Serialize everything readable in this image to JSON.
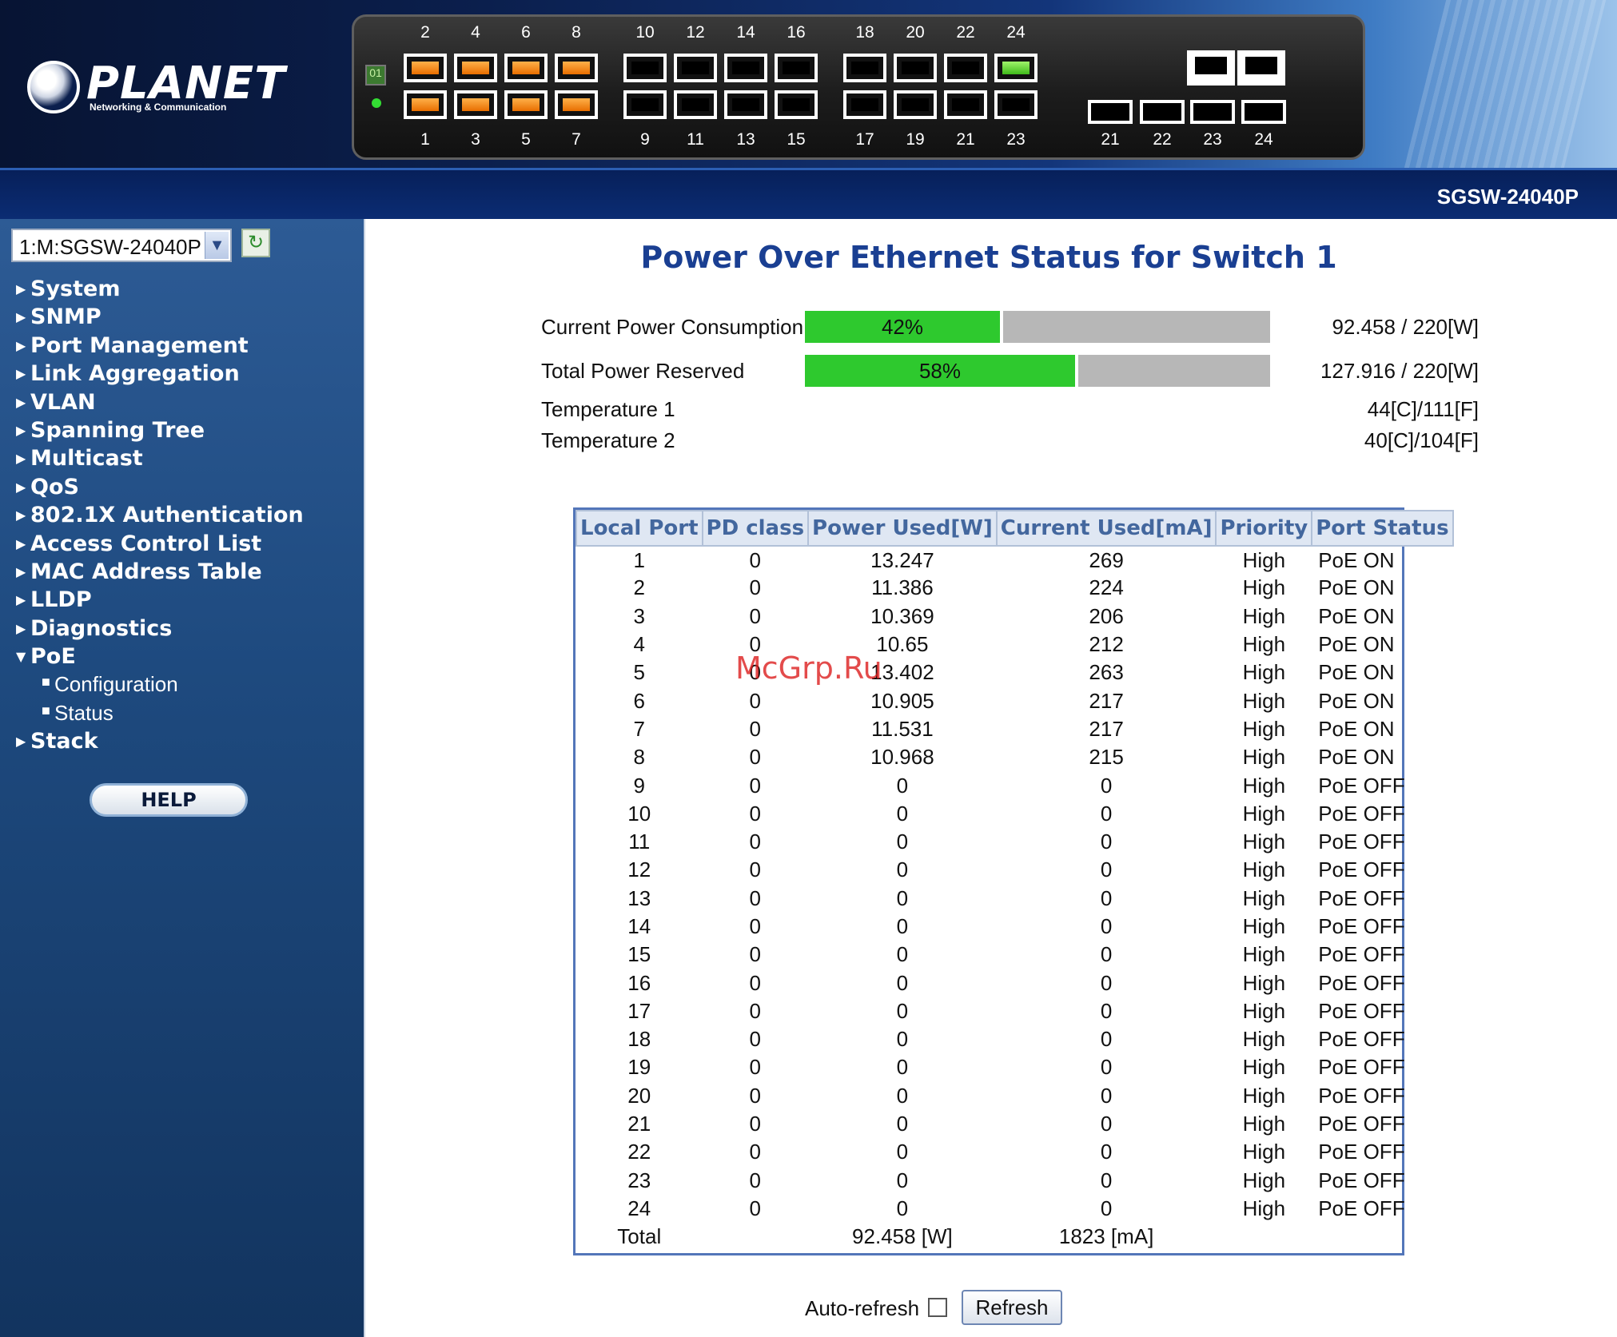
{
  "header": {
    "logo_name": "PLANET",
    "logo_tagline": "Networking & Communication",
    "model": "SGSW-24040P",
    "top_port_numbers": [
      "2",
      "4",
      "6",
      "8",
      "10",
      "12",
      "14",
      "16",
      "18",
      "20",
      "22",
      "24"
    ],
    "bottom_port_numbers": [
      "1",
      "3",
      "5",
      "7",
      "9",
      "11",
      "13",
      "15",
      "17",
      "19",
      "21",
      "23"
    ],
    "sfp_numbers": [
      "21",
      "22",
      "23",
      "24"
    ],
    "led_label": "01",
    "colors": {
      "port_active": "#f08a1c",
      "port_link": "#4fd12a",
      "led": "#33dd33"
    }
  },
  "sidebar": {
    "switch_select": "1:M:SGSW-24040P",
    "refresh_icon": "refresh-icon",
    "items": [
      {
        "label": "System"
      },
      {
        "label": "SNMP"
      },
      {
        "label": "Port Management"
      },
      {
        "label": "Link Aggregation"
      },
      {
        "label": "VLAN"
      },
      {
        "label": "Spanning Tree"
      },
      {
        "label": "Multicast"
      },
      {
        "label": "QoS"
      },
      {
        "label": "802.1X Authentication"
      },
      {
        "label": "Access Control List"
      },
      {
        "label": "MAC Address Table"
      },
      {
        "label": "LLDP"
      },
      {
        "label": "Diagnostics"
      },
      {
        "label": "PoE"
      },
      {
        "label": "Configuration"
      },
      {
        "label": "Status"
      },
      {
        "label": "Stack"
      }
    ],
    "help_label": "HELP"
  },
  "main": {
    "title": "Power Over Ethernet Status for Switch 1",
    "stats": {
      "consumption_label": "Current Power Consumption",
      "consumption_percent": "42%",
      "consumption_fraction": 0.42,
      "consumption_value": "92.458 / 220[W]",
      "reserved_label": "Total Power Reserved",
      "reserved_percent": "58%",
      "reserved_fraction": 0.58,
      "reserved_value": "127.916 / 220[W]",
      "temp1_label": "Temperature 1",
      "temp1_value": "44[C]/111[F]",
      "temp2_label": "Temperature 2",
      "temp2_value": "40[C]/104[F]"
    },
    "table": {
      "headers": [
        "Local Port",
        "PD class",
        "Power Used[W]",
        "Current Used[mA]",
        "Priority",
        "Port Status"
      ],
      "rows": [
        [
          "1",
          "0",
          "13.247",
          "269",
          "High",
          "PoE ON"
        ],
        [
          "2",
          "0",
          "11.386",
          "224",
          "High",
          "PoE ON"
        ],
        [
          "3",
          "0",
          "10.369",
          "206",
          "High",
          "PoE ON"
        ],
        [
          "4",
          "0",
          "10.65",
          "212",
          "High",
          "PoE ON"
        ],
        [
          "5",
          "0",
          "13.402",
          "263",
          "High",
          "PoE ON"
        ],
        [
          "6",
          "0",
          "10.905",
          "217",
          "High",
          "PoE ON"
        ],
        [
          "7",
          "0",
          "11.531",
          "217",
          "High",
          "PoE ON"
        ],
        [
          "8",
          "0",
          "10.968",
          "215",
          "High",
          "PoE ON"
        ],
        [
          "9",
          "0",
          "0",
          "0",
          "High",
          "PoE OFF"
        ],
        [
          "10",
          "0",
          "0",
          "0",
          "High",
          "PoE OFF"
        ],
        [
          "11",
          "0",
          "0",
          "0",
          "High",
          "PoE OFF"
        ],
        [
          "12",
          "0",
          "0",
          "0",
          "High",
          "PoE OFF"
        ],
        [
          "13",
          "0",
          "0",
          "0",
          "High",
          "PoE OFF"
        ],
        [
          "14",
          "0",
          "0",
          "0",
          "High",
          "PoE OFF"
        ],
        [
          "15",
          "0",
          "0",
          "0",
          "High",
          "PoE OFF"
        ],
        [
          "16",
          "0",
          "0",
          "0",
          "High",
          "PoE OFF"
        ],
        [
          "17",
          "0",
          "0",
          "0",
          "High",
          "PoE OFF"
        ],
        [
          "18",
          "0",
          "0",
          "0",
          "High",
          "PoE OFF"
        ],
        [
          "19",
          "0",
          "0",
          "0",
          "High",
          "PoE OFF"
        ],
        [
          "20",
          "0",
          "0",
          "0",
          "High",
          "PoE OFF"
        ],
        [
          "21",
          "0",
          "0",
          "0",
          "High",
          "PoE OFF"
        ],
        [
          "22",
          "0",
          "0",
          "0",
          "High",
          "PoE OFF"
        ],
        [
          "23",
          "0",
          "0",
          "0",
          "High",
          "PoE OFF"
        ],
        [
          "24",
          "0",
          "0",
          "0",
          "High",
          "PoE OFF"
        ]
      ],
      "total_label": "Total",
      "total_power": "92.458 [W]",
      "total_current": "1823 [mA]"
    },
    "auto_refresh_label": "Auto-refresh",
    "auto_refresh_checked": false,
    "refresh_button": "Refresh",
    "watermark": "McGrp.Ru"
  }
}
